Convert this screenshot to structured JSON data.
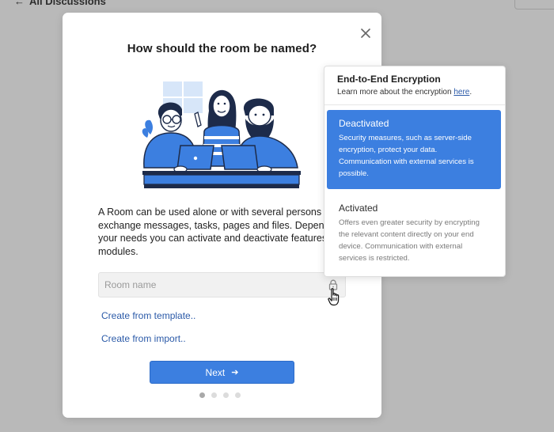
{
  "background": {
    "back_label": "All Discussions"
  },
  "modal": {
    "title": "How should the room be named?",
    "description_lines": [
      "A Room can be used alone or with several persons to",
      "exchange messages, tasks, pages and files. Depending on",
      "your needs you can activate and deactivate features or",
      "modules."
    ],
    "room_name_placeholder": "Room name",
    "room_name_value": "",
    "link_template": "Create from template..",
    "link_import": "Create from import..",
    "next_label": "Next",
    "pager": {
      "total": 4,
      "current": 1
    }
  },
  "encryption_popover": {
    "title": "End-to-End Encryption",
    "subtitle_prefix": "Learn more about the encryption ",
    "subtitle_link": "here",
    "subtitle_suffix": ".",
    "options": [
      {
        "title": "Deactivated",
        "selected": true,
        "description_lines": [
          "Security measures, such as server-side",
          "encryption, protect your data.",
          "Communication with external services is",
          "possible."
        ]
      },
      {
        "title": "Activated",
        "selected": false,
        "description_lines": [
          "Offers even greater security by encrypting",
          "the relevant content directly on your end",
          "device. Communication with external",
          "services is restricted."
        ]
      }
    ]
  },
  "colors": {
    "accent": "#3c7fe0",
    "link": "#2b5aa8",
    "overlay": "#b9b9b9",
    "illustration_blue": "#3c7fe0",
    "illustration_navy": "#1d2b4a"
  },
  "icons": {
    "close": "close-icon",
    "lock": "lock-icon",
    "next_arrow": "arrow-right-icon",
    "cursor": "hand-pointer-icon"
  }
}
